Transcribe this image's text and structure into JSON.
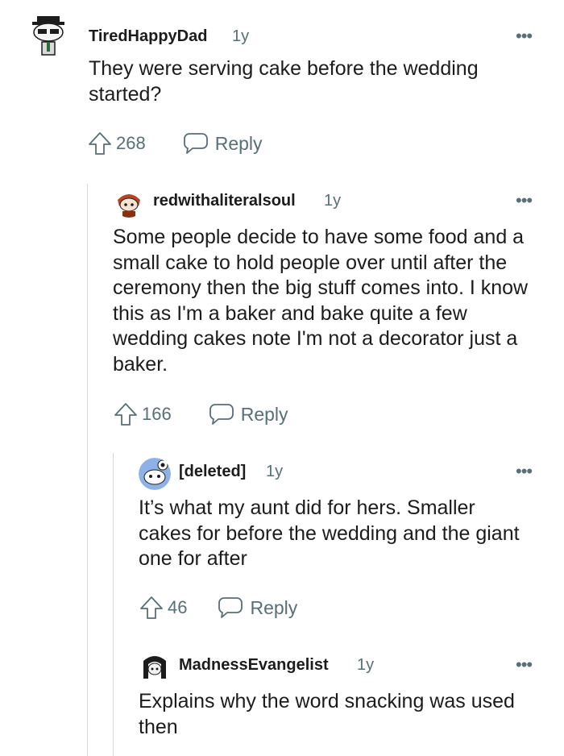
{
  "comments": [
    {
      "username": "TiredHappyDad",
      "age": "1y",
      "body": "They were serving cake before the wedding started?",
      "votes": "268",
      "reply_label": "Reply",
      "avatar_icon": "snoo-sunglasses-fedora-avatar"
    },
    {
      "username": "redwithaliteralsoul",
      "age": "1y",
      "body": "Some people decide to have some food and a small cake to hold people over until after the ceremony then the big stuff comes into. I know this as I'm a baker and bake quite a few wedding cakes note I'm not a decorator just a baker.",
      "votes": "166",
      "reply_label": "Reply",
      "avatar_icon": "snoo-red-hair-avatar"
    },
    {
      "username": "[deleted]",
      "age": "1y",
      "body": "It’s what my aunt did for hers. Smaller cakes for before the wedding and the giant one for after",
      "votes": "46",
      "reply_label": "Reply",
      "avatar_icon": "snoo-default-blue-avatar"
    },
    {
      "username": "MadnessEvangelist",
      "age": "1y",
      "body": "Explains why the word snacking was used then",
      "avatar_icon": "snoo-black-hair-avatar"
    }
  ],
  "more_icon": "ellipsis-icon",
  "colors": {
    "text": "#1c1c1c",
    "meta": "#576f76",
    "thread_line": "#d8d8d8"
  }
}
